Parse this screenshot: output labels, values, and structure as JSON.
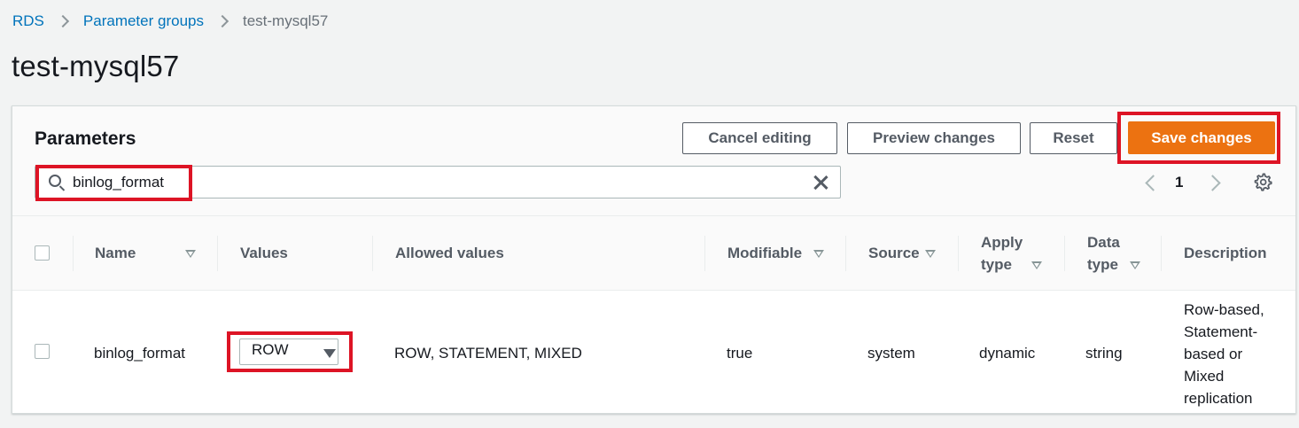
{
  "breadcrumb": {
    "items": [
      "RDS",
      "Parameter groups"
    ],
    "current": "test-mysql57"
  },
  "page": {
    "title": "test-mysql57"
  },
  "panel": {
    "title": "Parameters",
    "buttons": {
      "cancel": "Cancel editing",
      "preview": "Preview changes",
      "reset": "Reset",
      "save": "Save changes"
    },
    "search": {
      "value": "binlog_format",
      "placeholder": ""
    },
    "pagination": {
      "current_page": "1"
    }
  },
  "table": {
    "headers": {
      "name": "Name",
      "values": "Values",
      "allowed": "Allowed values",
      "modifiable": "Modifiable",
      "source": "Source",
      "apply_type_1": "Apply",
      "apply_type_2": "type",
      "data_type_1": "Data",
      "data_type_2": "type",
      "description": "Description"
    },
    "rows": [
      {
        "name": "binlog_format",
        "value": "ROW",
        "allowed": "ROW, STATEMENT, MIXED",
        "modifiable": "true",
        "source": "system",
        "apply_type": "dynamic",
        "data_type": "string",
        "description_lines": [
          "Row-based,",
          "Statement-",
          "based or",
          "Mixed",
          "replication"
        ]
      }
    ]
  },
  "colors": {
    "link": "#0073bb",
    "primary": "#ec7211",
    "highlight": "#dd1425",
    "text": "#16191f",
    "muted": "#545b64"
  },
  "icons": [
    "search-icon",
    "clear-icon",
    "chevron-left-icon",
    "chevron-right-icon",
    "gear-icon",
    "sort-icon",
    "caret-down-icon"
  ]
}
